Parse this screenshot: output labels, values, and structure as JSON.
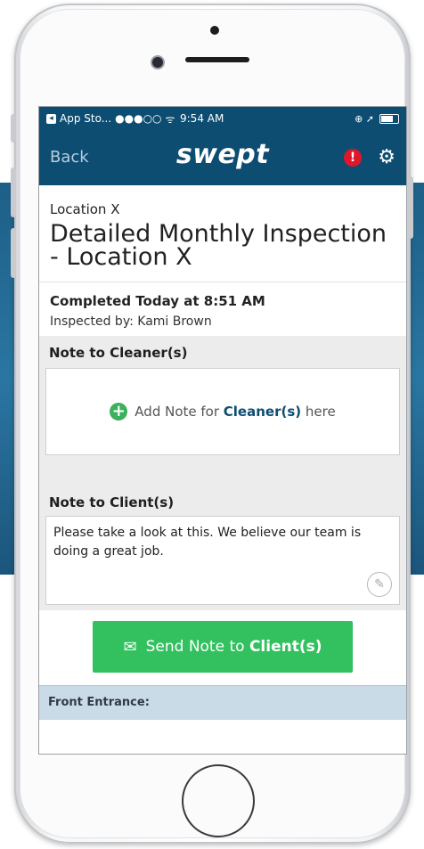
{
  "status_bar": {
    "back_app": "App Sto...",
    "signal": "●●●○○",
    "wifi": "ᯤ",
    "time": "9:54 AM",
    "right_icons": "⊕ ➚"
  },
  "nav": {
    "back_label": "Back",
    "title": "swept",
    "alert_symbol": "!",
    "gear_symbol": "⚙"
  },
  "location": {
    "name": "Location X",
    "title": "Detailed Monthly Inspection - Location X"
  },
  "completion": {
    "completed": "Completed Today at 8:51 AM",
    "inspected_by": "Inspected by: Kami Brown"
  },
  "cleaner_note": {
    "label": "Note to Cleaner(s)",
    "add_prefix": "Add Note for ",
    "add_strong": "Cleaner(s)",
    "add_suffix": " here",
    "plus_symbol": "+"
  },
  "client_note": {
    "label": "Note to Client(s)",
    "text": "Please take a look at this. We believe our team is doing a great job.",
    "edit_symbol": "✎"
  },
  "send_button": {
    "icon_symbol": "✉",
    "label_prefix": "Send Note to ",
    "label_strong": "Client(s)"
  },
  "section_footer": {
    "label": "Front Entrance:"
  },
  "colors": {
    "brand_navy": "#0d4d72",
    "alert_red": "#e0162b",
    "send_green": "#33c15f",
    "plus_green": "#3bb15b"
  }
}
